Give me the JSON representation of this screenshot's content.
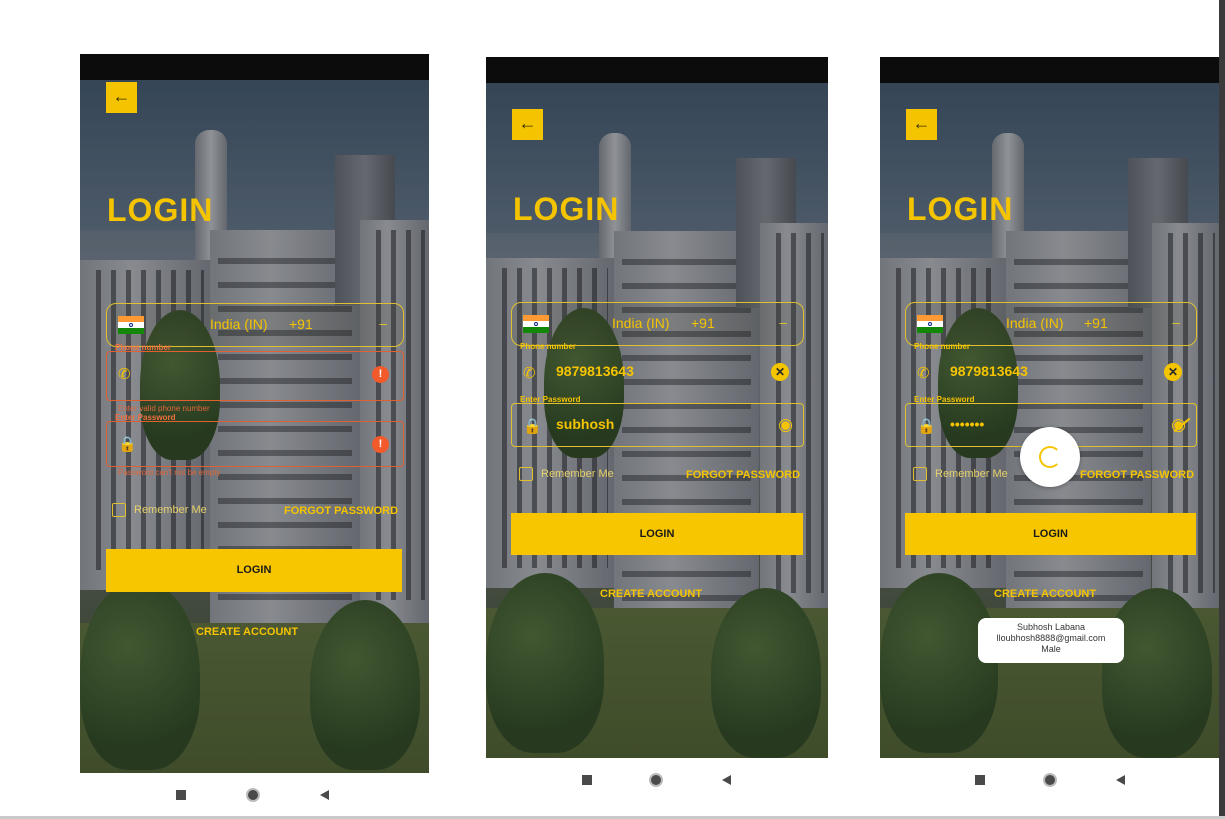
{
  "screens": [
    {
      "title": "LOGIN",
      "country": {
        "name": "India (IN)",
        "code": "+91"
      },
      "phone_field": {
        "label": "Phone number",
        "value": "",
        "error": "Enter valid phone number"
      },
      "password_field": {
        "label": "Enter Password",
        "value": "",
        "error": "Password can't not be empty"
      },
      "remember_me": "Remember Me",
      "forgot_password": "FORGOT PASSWORD",
      "login_button": "LOGIN",
      "create_account": "CREATE ACCOUNT"
    },
    {
      "title": "LOGIN",
      "country": {
        "name": "India (IN)",
        "code": "+91"
      },
      "phone_field": {
        "label": "Phone number",
        "value": "9879813643"
      },
      "password_field": {
        "label": "Enter Password",
        "value": "subhosh"
      },
      "remember_me": "Remember Me",
      "forgot_password": "FORGOT PASSWORD",
      "login_button": "LOGIN",
      "create_account": "CREATE ACCOUNT"
    },
    {
      "title": "LOGIN",
      "country": {
        "name": "India (IN)",
        "code": "+91"
      },
      "phone_field": {
        "label": "Phone number",
        "value": "9879813643"
      },
      "password_field": {
        "label": "Enter Password",
        "value": "•••••••"
      },
      "remember_me": "Remember Me",
      "forgot_password": "FORGOT PASSWORD",
      "login_button": "LOGIN",
      "create_account": "CREATE ACCOUNT",
      "toast": {
        "name": "Subhosh Labana",
        "email": "lloubhosh8888@gmail.com",
        "gender": "Male"
      }
    }
  ],
  "icons": {
    "back": "arrow-left-icon",
    "phone": "phone-icon",
    "lock": "lock-icon",
    "error": "error-icon",
    "clear": "clear-icon",
    "eye": "eye-icon",
    "eye_off": "eye-off-icon",
    "dropdown": "dropdown-icon"
  },
  "colors": {
    "accent": "#f5c400",
    "error": "#f25a2c",
    "button_text": "#1a1a1a"
  }
}
